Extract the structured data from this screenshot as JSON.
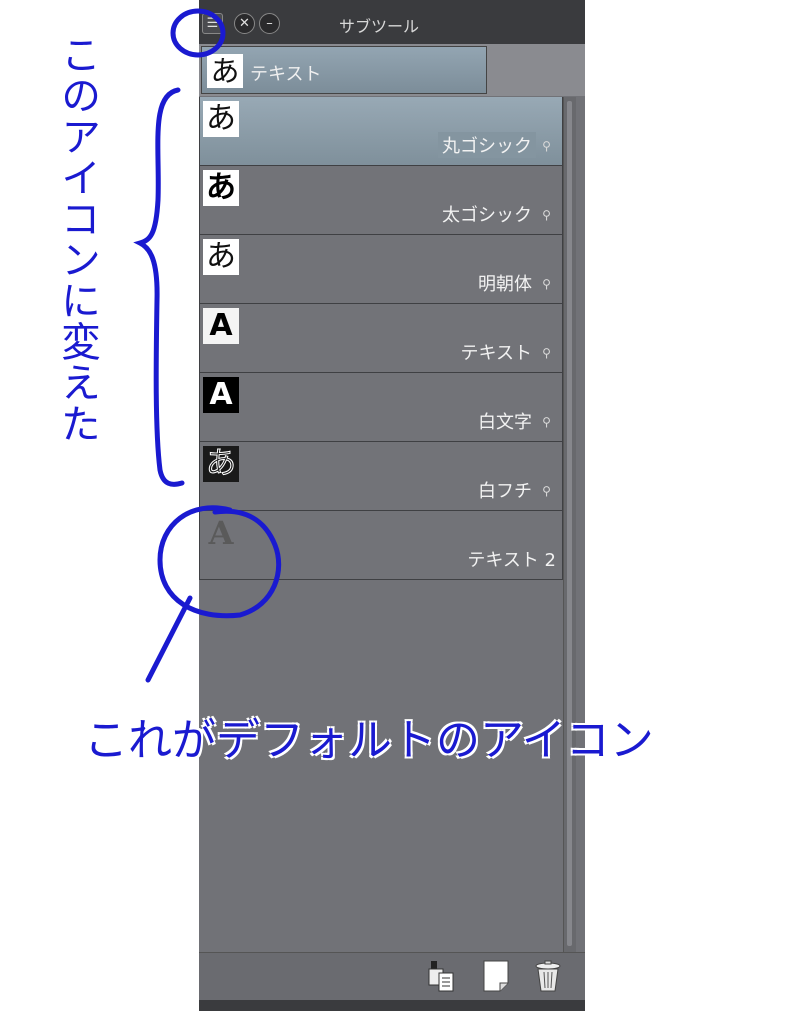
{
  "window": {
    "title": "サブツール"
  },
  "titlebar_icons": [
    "menu-icon",
    "close-icon",
    "minimize-icon"
  ],
  "tab": {
    "glyph": "あ",
    "label": "テキスト"
  },
  "subtools": [
    {
      "glyph": "あ",
      "style": "white",
      "name": "丸ゴシック",
      "selected": true,
      "has_key": true
    },
    {
      "glyph": "あ",
      "style": "bold",
      "name": "太ゴシック",
      "selected": false,
      "has_key": true
    },
    {
      "glyph": "あ",
      "style": "serif",
      "name": "明朝体",
      "selected": false,
      "has_key": true
    },
    {
      "glyph": "A",
      "style": "latin",
      "name": "テキスト",
      "selected": false,
      "has_key": true
    },
    {
      "glyph": "A",
      "style": "blk",
      "name": "白文字",
      "selected": false,
      "has_key": true
    },
    {
      "glyph": "あ",
      "style": "outline",
      "name": "白フチ",
      "selected": false,
      "has_key": true
    },
    {
      "glyph": "A",
      "style": "default",
      "name": "テキスト 2",
      "selected": false,
      "has_key": false
    }
  ],
  "bottom_icons": [
    "sub-tool-property-icon",
    "new-sub-tool-icon",
    "delete-sub-tool-icon"
  ],
  "annotations": {
    "vertical_note": "このアイコンに変えた",
    "horizontal_note": "これがデフォルトのアイコン",
    "color": "#1a1ad0"
  }
}
